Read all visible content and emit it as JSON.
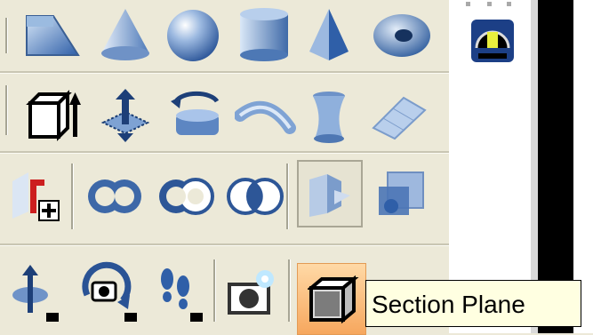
{
  "toolbar": {
    "row1": [
      "wedge-icon",
      "cone-icon",
      "sphere-icon",
      "cylinder-icon",
      "pyramid-icon",
      "torus-icon"
    ],
    "row2": [
      "extrude-icon",
      "presspull-icon",
      "revolve-icon",
      "sweep-icon",
      "loft-icon",
      "planar-surface-icon"
    ],
    "row3": [
      "extract-edges-icon",
      "union-icon",
      "subtract-icon",
      "intersect-icon",
      "slice-icon",
      "interfere-icon"
    ],
    "row4": [
      "3d-move-icon",
      "3d-orbit-icon",
      "walk-icon",
      "render-icon",
      "section-plane-icon"
    ]
  },
  "tooltip": {
    "text": "Section Plane"
  },
  "colors": {
    "panel": "#ece9d8",
    "highlight": "#f6a75e",
    "tooltip_bg": "#ffffe1"
  }
}
